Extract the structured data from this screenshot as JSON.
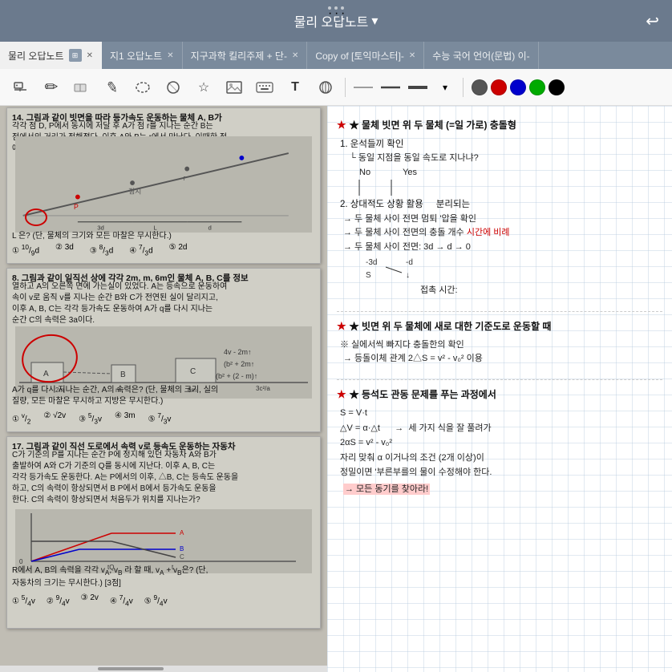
{
  "titleBar": {
    "dots": [
      "·",
      "·",
      "·"
    ],
    "title": "물리 오답노트",
    "chevron": "▾",
    "backIcon": "↩"
  },
  "tabs": [
    {
      "label": "물리 오답노트",
      "active": true,
      "closable": true
    },
    {
      "label": "지1 오답노트",
      "active": false,
      "closable": true
    },
    {
      "label": "지구과학 킬리주제 + 단-",
      "active": false,
      "closable": true
    },
    {
      "label": "Copy of [토익마스터]-",
      "active": false,
      "closable": true
    },
    {
      "label": "수능 국어 언어(문법) 이-",
      "active": false,
      "closable": false
    }
  ],
  "toolbar": {
    "tools": [
      {
        "name": "search",
        "icon": "🔍"
      },
      {
        "name": "pen",
        "icon": "✏"
      },
      {
        "name": "eraser",
        "icon": "⬜"
      },
      {
        "name": "pencil",
        "icon": "✎"
      },
      {
        "name": "lasso",
        "icon": "⭕"
      },
      {
        "name": "shapes",
        "icon": "⬟"
      },
      {
        "name": "star",
        "icon": "☆"
      },
      {
        "name": "image",
        "icon": "🖼"
      },
      {
        "name": "keyboard",
        "icon": "⌨"
      },
      {
        "name": "text",
        "icon": "T"
      },
      {
        "name": "link",
        "icon": "⊕"
      }
    ],
    "lineOptions": [
      "—",
      "—",
      "—",
      "▾"
    ],
    "colors": [
      "#555555",
      "#cc0000",
      "#0000cc",
      "#00aa00",
      "#000000"
    ]
  },
  "rightPanel": {
    "section1": {
      "title": "★ 물체 빗면 위 두 물체 (=일 가로) 충돌형",
      "items": [
        "1. 운석들끼 확인",
        "→ 동일 지점을 동일 속도로 지나냐?",
        "No / Yes",
        "2. 상대적도 상황 활용 - 분리되는",
        "→ 두 물체 사이 전면 멈퇴 '압을 확인",
        "→ 두 물체 사이 전면의 충돌 개수 시간에 비례",
        "→ 두 물체 사이 전면: 3d → d → 0",
        "접촉 시간:"
      ]
    },
    "section2": {
      "title": "★ 빗면 위 두 물체에 새로 대한 기준도로 운동할 때",
      "items": [
        "※ 실에서씩 빠지다 충돌한의 확인",
        "→ 등돌이체 관계 2△S = v² - v₀² 이용"
      ]
    },
    "section3": {
      "title": "★ 등석도 관동 문제를 푸는 과정에서",
      "items": [
        "S = V·t",
        "△V = α·△t → 세 가지 식을 잘 풀려가",
        "2αS = v² - v₀²",
        "자리 맞춰 α 이거나의 조건 (2개 이상)이",
        "정밀이면 '부른부를의 물이 수정해야 한다.",
        "→ 모든 동기를 찾아라!"
      ]
    }
  },
  "colors": {
    "titleBg": "#6b7a8d",
    "tabBarBg": "#7a8a9c",
    "toolbarBg": "#f8f8f8",
    "gridLine": "#b8ccd8",
    "accentRed": "#cc0000",
    "accentBlue": "#0000cc"
  }
}
